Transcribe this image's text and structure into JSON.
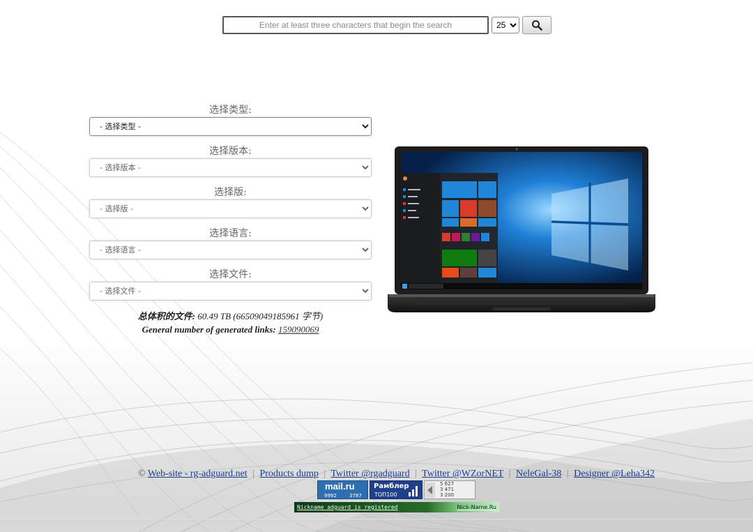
{
  "search": {
    "placeholder": "Enter at least three characters that begin the search",
    "page_size_selected": "25"
  },
  "form": {
    "fields": [
      {
        "label": "选择类型:",
        "selected": "- 选择类型 -"
      },
      {
        "label": "选择版本:",
        "selected": "- 选择版本 -"
      },
      {
        "label": "选择版:",
        "selected": "- 选择版 -"
      },
      {
        "label": "选择语言:",
        "selected": "- 选择语言 -"
      },
      {
        "label": "选择文件:",
        "selected": "- 选择文件 -"
      }
    ]
  },
  "stats": {
    "total_label": "总体积的文件:",
    "total_value": "60.49 TB (66509049185961 字节)",
    "links_label": "General number of generated links:",
    "links_value": "159090069"
  },
  "footer": {
    "copyright": "©",
    "links": [
      "Web-site - rg-adguard.net",
      "Products dump",
      "Twitter @rgadguard",
      "Twitter @WZorNET",
      "NeleGal-38",
      "Designer @Leha342"
    ],
    "counters": {
      "mailru_logo": "mail.ru",
      "mailru_left": "9992",
      "mailru_right": "3787",
      "rambler_name": "Рамблер",
      "rambler_sub": "ТОП100",
      "li_line1": "5 627",
      "li_line2": "3 471",
      "li_line3": "3 200"
    },
    "nick_left": "Nickname adguard is registered",
    "nick_right": "Nick-Name.Ru"
  },
  "icons": {
    "search_button": "search-icon",
    "select_arrow": "chevron-down-icon"
  },
  "colors": {
    "link": "#1a3d8c",
    "mailru_bg": "#2d6fb1",
    "rambler_bg": "#1f3f8b",
    "nick_bg": "#276b2a"
  }
}
